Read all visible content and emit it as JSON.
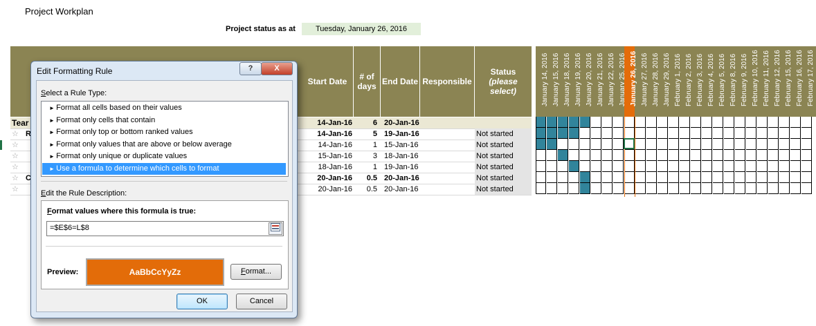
{
  "sheet": {
    "title": "Project Workplan",
    "status_label": "Project status as at",
    "status_date": "Tuesday, January 26, 2016",
    "headers": {
      "start_date": "Start Date",
      "days": "# of days",
      "end_date": "End Date",
      "responsible": "Responsible",
      "status": "Status",
      "status_hint": "(please select)"
    },
    "rows": [
      {
        "task": "Tear",
        "start": "14-Jan-16",
        "days": "6",
        "end": "20-Jan-16",
        "status": "",
        "bold": true
      },
      {
        "task": "R",
        "start": "14-Jan-16",
        "days": "5",
        "end": "19-Jan-16",
        "status": "Not started",
        "bold": true
      },
      {
        "task": "",
        "start": "14-Jan-16",
        "days": "1",
        "end": "15-Jan-16",
        "status": "Not started",
        "bold": false
      },
      {
        "task": "",
        "start": "15-Jan-16",
        "days": "3",
        "end": "18-Jan-16",
        "status": "Not started",
        "bold": false
      },
      {
        "task": "",
        "start": "18-Jan-16",
        "days": "1",
        "end": "19-Jan-16",
        "status": "Not started",
        "bold": false
      },
      {
        "task": "C",
        "start": "20-Jan-16",
        "days": "0.5",
        "end": "20-Jan-16",
        "status": "Not started",
        "bold": true
      },
      {
        "task": "",
        "start": "20-Jan-16",
        "days": "0.5",
        "end": "20-Jan-16",
        "status": "Not started",
        "bold": false
      }
    ],
    "dates": [
      "January 14, 2016",
      "January 15, 2016",
      "January 18, 2016",
      "January 19, 2016",
      "January 20, 2016",
      "January 21, 2016",
      "January 22, 2016",
      "January 25, 2016",
      "January 26, 2016",
      "January 27, 2016",
      "January 28, 2016",
      "January 29, 2016",
      "February 1, 2016",
      "February 2, 2016",
      "February 3, 2016",
      "February 4, 2016",
      "February 5, 2016",
      "February 8, 2016",
      "February 9, 2016",
      "February 10, 2016",
      "February 11, 2016",
      "February 12, 2016",
      "February 15, 2016",
      "February 16, 2016",
      "February 17, 2016"
    ],
    "today_index": 8,
    "gantt_fill": [
      [
        0,
        1,
        2,
        3,
        4
      ],
      [
        0,
        1,
        2,
        3
      ],
      [
        0,
        1
      ],
      [
        2
      ],
      [
        3
      ],
      [
        4
      ],
      [
        4
      ]
    ],
    "colors": {
      "header": "#8b8453",
      "bar": "#31849b",
      "today": "#e46c0a",
      "status_bg": "#e2efda"
    }
  },
  "dialog": {
    "title": "Edit Formatting Rule",
    "help_label": "?",
    "close_label": "X",
    "select_rule_type_prefix": "S",
    "select_rule_type_rest": "elect a Rule Type:",
    "rule_types": [
      "Format all cells based on their values",
      "Format only cells that contain",
      "Format only top or bottom ranked values",
      "Format only values that are above or below average",
      "Format only unique or duplicate values",
      "Use a formula to determine which cells to format"
    ],
    "selected_rule": 5,
    "edit_desc_prefix": "E",
    "edit_desc_rest": "dit the Rule Description:",
    "formula_label_prefix": "F",
    "formula_label_rest": "ormat values where this formula is true:",
    "formula": "=$E$6=L$8",
    "preview_label": "Preview:",
    "preview_text": "AaBbCcYyZz",
    "preview_color": "#e36c09",
    "format_button_prefix": "F",
    "format_button_rest": "ormat...",
    "ok_label": "OK",
    "cancel_label": "Cancel"
  }
}
